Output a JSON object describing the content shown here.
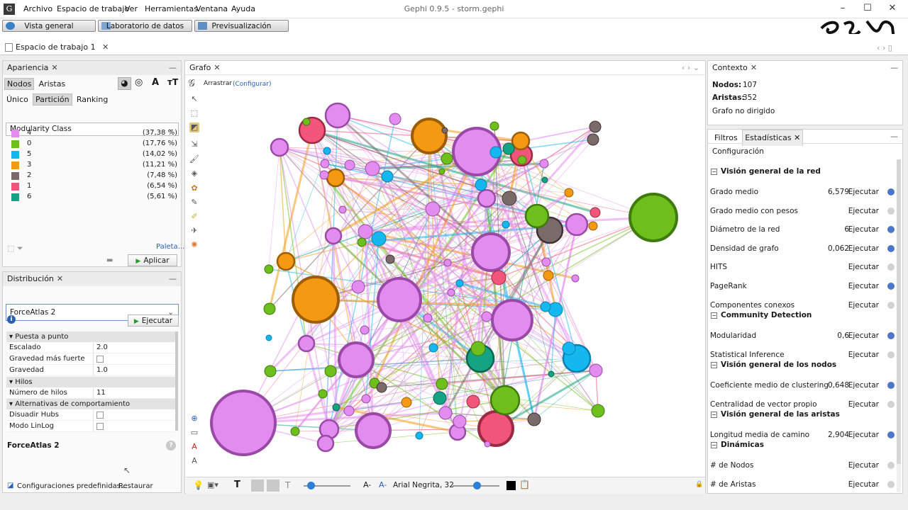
{
  "app": {
    "title": "Gephi 0.9.5 - storm.gephi",
    "menu": [
      "Archivo",
      "Espacio de trabajo",
      "Ver",
      "Herramientas",
      "Ventana",
      "Ayuda"
    ]
  },
  "views": {
    "overview": "Vista general",
    "data_lab": "Laboratorio de datos",
    "preview": "Previsualización"
  },
  "workspace": {
    "tab": "Espacio de trabajo 1"
  },
  "appearance": {
    "title": "Apariencia",
    "tabs": [
      "Nodos",
      "Aristas"
    ],
    "modes": [
      "Único",
      "Partición",
      "Ranking"
    ],
    "attribute": "Modularity Class",
    "partition": [
      {
        "name": "4",
        "pct": "(37,38 %)",
        "color": "#e38cf0"
      },
      {
        "name": "0",
        "pct": "(17,76 %)",
        "color": "#6fbf1c"
      },
      {
        "name": "5",
        "pct": "(14,02 %)",
        "color": "#14b8ef"
      },
      {
        "name": "3",
        "pct": "(11,21 %)",
        "color": "#f39a12"
      },
      {
        "name": "2",
        "pct": "(7,48 %)",
        "color": "#7b6a6a"
      },
      {
        "name": "1",
        "pct": "(6,54 %)",
        "color": "#f1557a"
      },
      {
        "name": "6",
        "pct": "(5,61 %)",
        "color": "#14a383"
      }
    ],
    "palette": "Paleta...",
    "apply": "Aplicar"
  },
  "layout": {
    "title": "Distribución",
    "algorithm": "ForceAtlas 2",
    "run": "Ejecutar",
    "cat_tuning": "Puesta a punto",
    "scaling_label": "Escalado",
    "scaling": "2.0",
    "strong_gravity_label": "Gravedad más fuerte",
    "gravity_label": "Gravedad",
    "gravity": "1.0",
    "cat_threads": "Hilos",
    "threads_label": "Número de hilos",
    "threads": "11",
    "cat_behavior": "Alternativas de comportamiento",
    "dissuade_label": "Disuadir Hubs",
    "linlog_label": "Modo LinLog",
    "desc_title": "ForceAtlas 2",
    "presets": "Configuraciones predefinidas...",
    "restore": "Restaurar"
  },
  "graph": {
    "tab": "Grafo",
    "drag": "Arrastrar",
    "configure": "(Configurar)",
    "font": "Arial Negrita, 32"
  },
  "context": {
    "title": "Contexto",
    "nodes_label": "Nodos:",
    "nodes": "107",
    "edges_label": "Aristas:",
    "edges": "352",
    "kind": "Grafo no dirigido"
  },
  "stats": {
    "tabs": [
      "Filtros",
      "Estadísticas"
    ],
    "config": "Configuración",
    "run": "Ejecutar",
    "sections": [
      {
        "title": "Visión general de la red",
        "rows": [
          {
            "name": "Grado medio",
            "value": "6,579",
            "info": true
          },
          {
            "name": "Grado medio con pesos",
            "value": "",
            "info": false
          },
          {
            "name": "Diámetro de la red",
            "value": "6",
            "info": true
          },
          {
            "name": "Densidad de grafo",
            "value": "0,062",
            "info": true
          },
          {
            "name": "HITS",
            "value": "",
            "info": false
          },
          {
            "name": "PageRank",
            "value": "",
            "info": true
          },
          {
            "name": "Componentes conexos",
            "value": "",
            "info": false
          }
        ]
      },
      {
        "title": "Community Detection",
        "rows": [
          {
            "name": "Modularidad",
            "value": "0,6",
            "info": true
          },
          {
            "name": "Statistical Inference",
            "value": "",
            "info": false
          }
        ]
      },
      {
        "title": "Visión general de los nodos",
        "rows": [
          {
            "name": "Coeficiente medio de clustering",
            "value": "0,648",
            "info": true
          },
          {
            "name": "Centralidad de vector propio",
            "value": "",
            "info": false
          }
        ]
      },
      {
        "title": "Visión general de las aristas",
        "rows": [
          {
            "name": "Longitud media de camino",
            "value": "2,904",
            "info": true
          }
        ]
      },
      {
        "title": "Dinámicas",
        "rows": [
          {
            "name": "# de Nodos",
            "value": "",
            "info": false
          },
          {
            "name": "# de Aristas",
            "value": "",
            "info": false
          }
        ]
      }
    ]
  }
}
